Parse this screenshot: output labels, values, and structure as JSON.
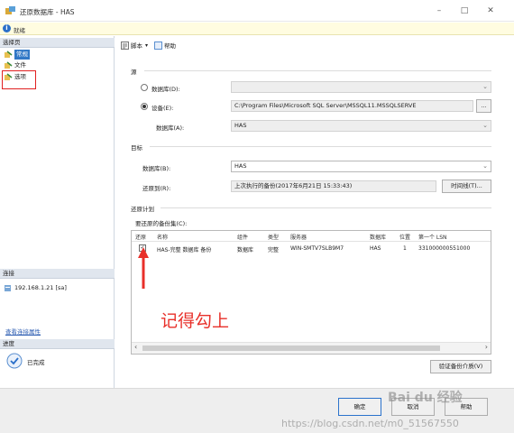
{
  "window": {
    "title": "还原数据库 - HAS",
    "minimize_glyph": "–",
    "maximize_glyph": "□",
    "close_glyph": "✕"
  },
  "status": {
    "text": "就绪",
    "icon_glyph": "i"
  },
  "sidebar": {
    "select_page_header": "选择页",
    "pages": [
      {
        "label": "常规",
        "selected": true
      },
      {
        "label": "文件",
        "selected": false
      },
      {
        "label": "选项",
        "selected": false
      }
    ],
    "connection_header": "连接",
    "connection_value": "192.168.1.21 [sa]",
    "view_connection_link": "查看连接属性",
    "progress_header": "进度",
    "progress_status": "已完成"
  },
  "toolbar": {
    "script_label": "脚本",
    "script_arrow": "▾",
    "help_label": "帮助"
  },
  "source": {
    "group_label": "源",
    "database_radio_label": "数据库(D):",
    "device_radio_label": "设备(E):",
    "device_path": "C:\\Program Files\\Microsoft SQL Server\\MSSQL11.MSSQLSERVE",
    "browse_label": "...",
    "database_label": "数据库(A):",
    "database_value": "HAS"
  },
  "target": {
    "group_label": "目标",
    "database_label": "数据库(B):",
    "database_value": "HAS",
    "restore_to_label": "还原到(R):",
    "restore_to_value": "上次执行的备份(2017年6月21日 15:33:43)",
    "timeline_button": "时间线(T)..."
  },
  "restore_plan": {
    "group_label": "还原计划",
    "backup_sets_label": "要还原的备份集(C):",
    "columns": [
      "还原",
      "名称",
      "组件",
      "类型",
      "服务器",
      "数据库",
      "位置",
      "第一个 LSN"
    ],
    "rows": [
      {
        "restore": true,
        "name": "HAS-完整 数据库 备份",
        "component": "数据库",
        "type": "完整",
        "server": "WIN-SMTV7SLB9M7",
        "database": "HAS",
        "position": "1",
        "first_lsn": "331000000551000"
      }
    ],
    "scroll_left": "‹",
    "scroll_right": "›",
    "verify_button": "验证备份介质(V)"
  },
  "annotation": {
    "text": "记得勾上",
    "color": "#e8302a"
  },
  "footer": {
    "ok_button": "确定",
    "cancel_button": "取消",
    "help_button": "帮助"
  },
  "watermark": {
    "baidu_text": "Bai du 经验",
    "url_text": "https://blog.csdn.net/m0_51567550"
  },
  "colors": {
    "selected_page": "#3178c6",
    "red_box": "#e02020",
    "status_bar": "#fffce0"
  }
}
